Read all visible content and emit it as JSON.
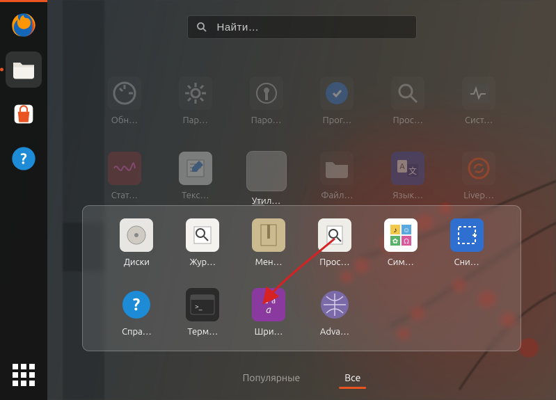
{
  "search": {
    "placeholder": "Найти…"
  },
  "dock": {
    "items": [
      {
        "name": "firefox"
      },
      {
        "name": "files"
      },
      {
        "name": "software"
      },
      {
        "name": "help"
      }
    ]
  },
  "grid_row1": [
    {
      "label": "Обн…",
      "icon": "updater"
    },
    {
      "label": "Пар…",
      "icon": "settings"
    },
    {
      "label": "Паро…",
      "icon": "passwords"
    },
    {
      "label": "Прог…",
      "icon": "software-center"
    },
    {
      "label": "Прос…",
      "icon": "image-viewer"
    },
    {
      "label": "Сист…",
      "icon": "system-monitor"
    }
  ],
  "grid_row2": [
    {
      "label": "Стат…",
      "icon": "power-stats"
    },
    {
      "label": "Текс…",
      "icon": "text-editor"
    },
    {
      "label": "Утил…",
      "icon": "utilities-folder"
    },
    {
      "label": "Файл…",
      "icon": "files-grey"
    },
    {
      "label": "Язык…",
      "icon": "language"
    },
    {
      "label": "Livep…",
      "icon": "livepatch"
    }
  ],
  "folder": {
    "row1": [
      {
        "label": "Диски",
        "icon": "disks"
      },
      {
        "label": "Жур…",
        "icon": "logs"
      },
      {
        "label": "Мен…",
        "icon": "archive"
      },
      {
        "label": "Прос…",
        "icon": "doc-viewer"
      },
      {
        "label": "Сим…",
        "icon": "characters"
      },
      {
        "label": "Сни…",
        "icon": "screenshot"
      }
    ],
    "row2": [
      {
        "label": "Спра…",
        "icon": "help-blue"
      },
      {
        "label": "Терм…",
        "icon": "terminal"
      },
      {
        "label": "Шри…",
        "icon": "fonts"
      },
      {
        "label": "Adva…",
        "icon": "advanced-net"
      }
    ]
  },
  "tabs": {
    "frequent": "Популярные",
    "all": "Все"
  },
  "colors": {
    "accent": "#E95420"
  }
}
